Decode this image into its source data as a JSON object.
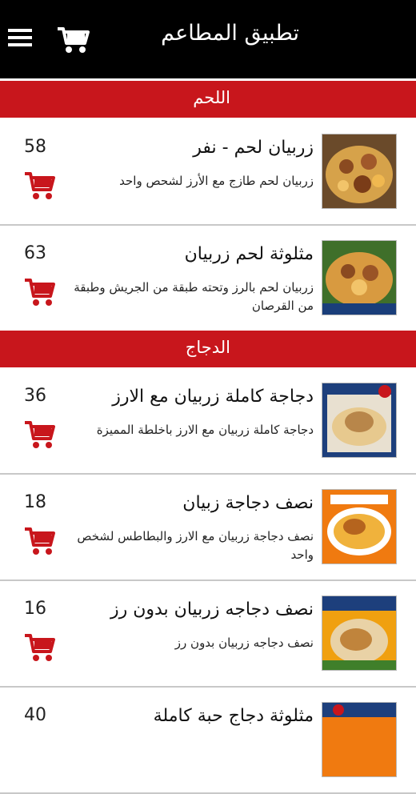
{
  "header": {
    "title": "تطبيق المطاعم",
    "menu_icon": "hamburger-menu-icon",
    "cart_icon": "shopping-cart-icon"
  },
  "colors": {
    "accent": "#c8161c",
    "header_bg": "#000000",
    "divider": "#c8c8c8"
  },
  "sections": [
    {
      "title": "اللحم",
      "items": [
        {
          "name": "زربيان لحم - نفر",
          "description": "زربيان لحم طازج مع الأرز لشحص واحد",
          "count": "58",
          "cart_icon": "add-to-cart-icon"
        },
        {
          "name": "مثلوثة لحم زربيان",
          "description": "زربيان لحم بالرز وتحته طبقة من الجريش وطبقة من القرصان",
          "count": "63",
          "cart_icon": "add-to-cart-icon"
        }
      ]
    },
    {
      "title": "الدجاج",
      "items": [
        {
          "name": "دجاجة كاملة زربيان مع الارز",
          "description": "دجاجة كاملة زربيان مع الارز باخلطة المميزة",
          "count": "36",
          "cart_icon": "add-to-cart-icon"
        },
        {
          "name": "نصف دجاجة زبيان",
          "description": "نصف دجاجة زربيان مع الارز والبطاطس لشخص واحد",
          "count": "18",
          "cart_icon": "add-to-cart-icon"
        },
        {
          "name": "نصف دجاجه زربيان بدون رز",
          "description": "نصف دجاجه زربيان بدون رز",
          "count": "16",
          "cart_icon": "add-to-cart-icon"
        },
        {
          "name": "مثلوثة دجاج حبة كاملة",
          "description": "",
          "count": "40",
          "cart_icon": "add-to-cart-icon"
        }
      ]
    }
  ]
}
